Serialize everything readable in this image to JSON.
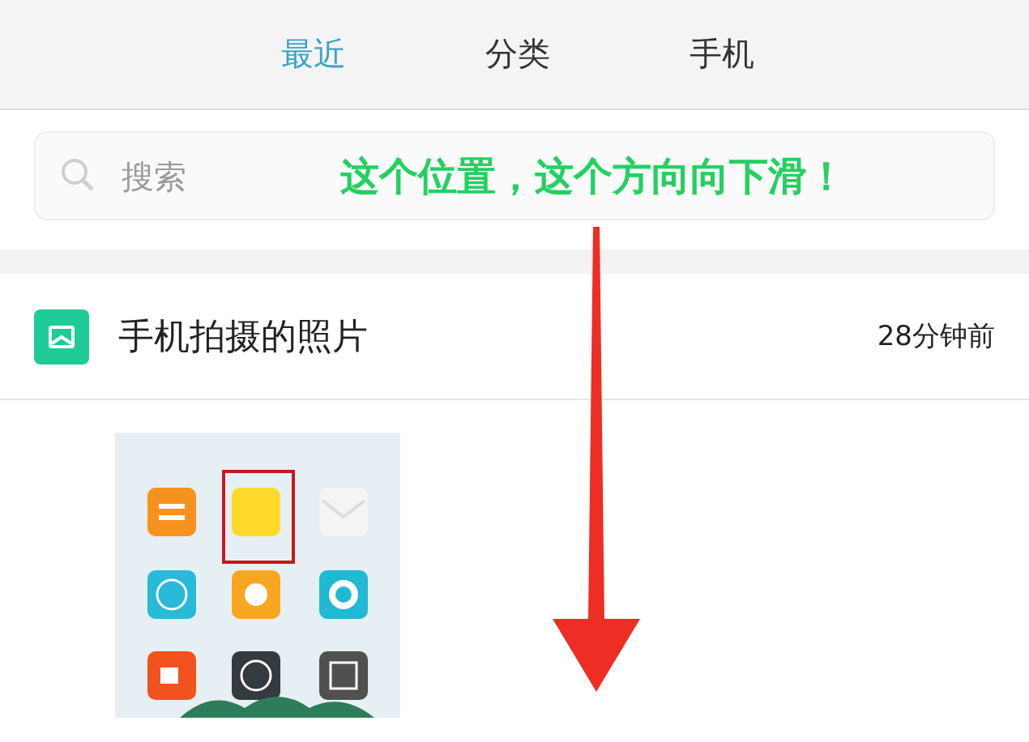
{
  "tabs": [
    {
      "label": "最近",
      "selected": true
    },
    {
      "label": "分类",
      "selected": false
    },
    {
      "label": "手机",
      "selected": false
    }
  ],
  "search": {
    "placeholder": "搜索"
  },
  "annotation": {
    "text": "这个位置，这个方向向下滑！"
  },
  "recent_group": {
    "title": "手机拍摄的照片",
    "time": "28分钟前"
  }
}
